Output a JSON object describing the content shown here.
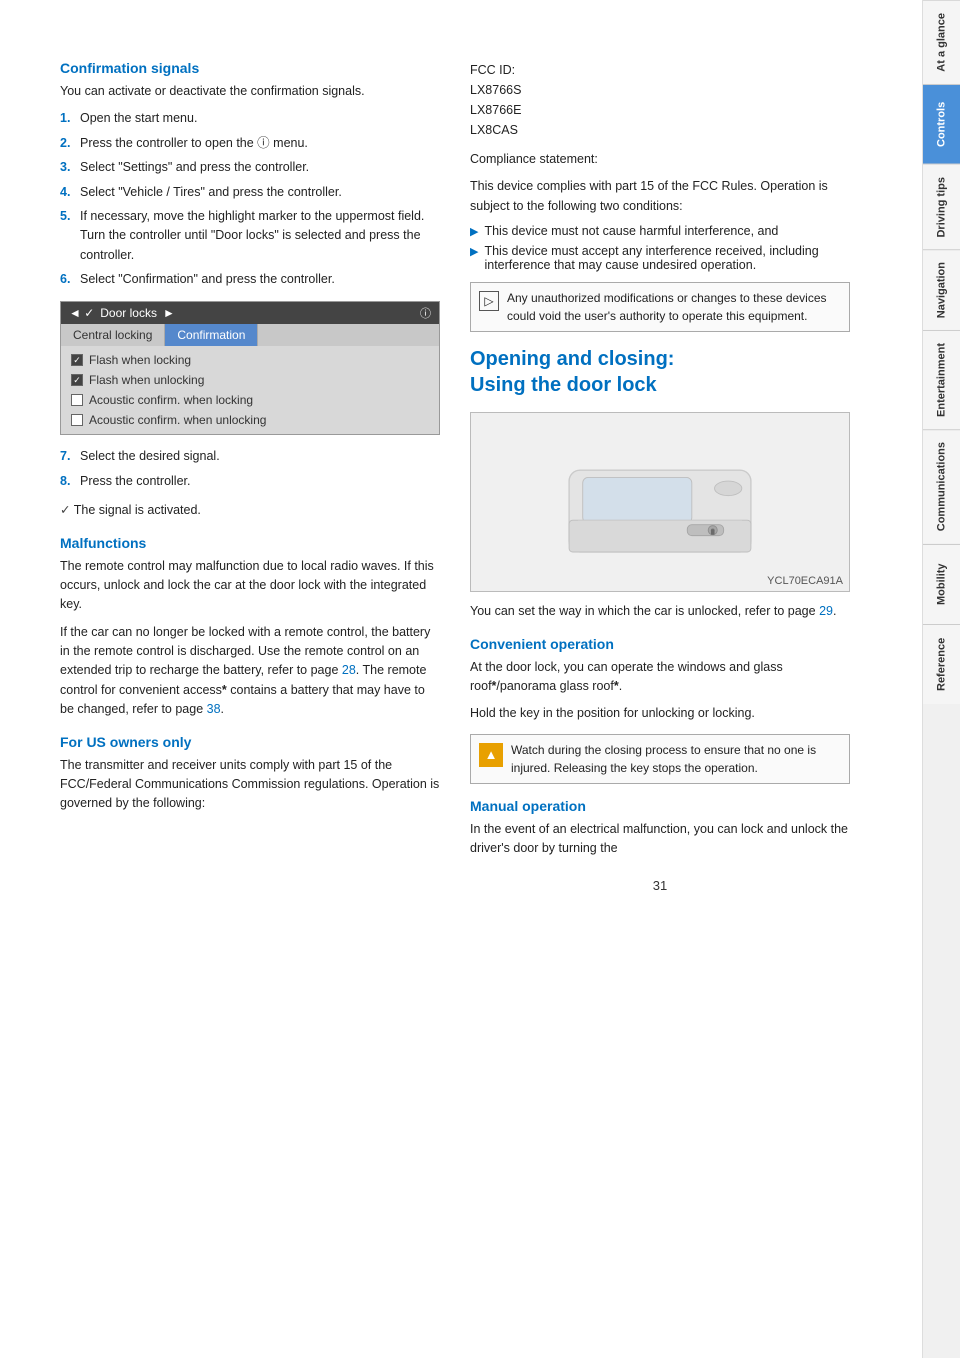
{
  "page": {
    "number": "31"
  },
  "sidebar": {
    "tabs": [
      {
        "id": "at-a-glance",
        "label": "At a glance",
        "active": false
      },
      {
        "id": "controls",
        "label": "Controls",
        "active": true
      },
      {
        "id": "driving-tips",
        "label": "Driving tips",
        "active": false
      },
      {
        "id": "navigation",
        "label": "Navigation",
        "active": false
      },
      {
        "id": "entertainment",
        "label": "Entertainment",
        "active": false
      },
      {
        "id": "communications",
        "label": "Communications",
        "active": false
      },
      {
        "id": "mobility",
        "label": "Mobility",
        "active": false
      },
      {
        "id": "reference",
        "label": "Reference",
        "active": false
      }
    ]
  },
  "left_column": {
    "confirmation_signals": {
      "heading": "Confirmation signals",
      "intro": "You can activate or deactivate the confirmation signals.",
      "steps": [
        {
          "num": "1.",
          "text": "Open the start menu."
        },
        {
          "num": "2.",
          "text": "Press the controller to open the ⓘ menu."
        },
        {
          "num": "3.",
          "text": "Select \"Settings\" and press the controller."
        },
        {
          "num": "4.",
          "text": "Select \"Vehicle / Tires\" and press the controller."
        },
        {
          "num": "5.",
          "text": "If necessary, move the highlight marker to the uppermost field. Turn the controller until \"Door locks\" is selected and press the controller."
        },
        {
          "num": "6.",
          "text": "Select \"Confirmation\" and press the controller."
        }
      ],
      "door_locks_ui": {
        "header_title": "Door locks",
        "tab_central": "Central locking",
        "tab_confirmation": "Confirmation",
        "options": [
          {
            "checked": true,
            "label": "Flash when locking"
          },
          {
            "checked": true,
            "label": "Flash when unlocking"
          },
          {
            "checked": false,
            "label": "Acoustic confirm. when locking"
          },
          {
            "checked": false,
            "label": "Acoustic confirm. when unlocking"
          }
        ]
      },
      "steps2": [
        {
          "num": "7.",
          "text": "Select the desired signal."
        },
        {
          "num": "8.",
          "text": "Press the controller."
        }
      ],
      "checkmark_note": "The signal is activated."
    },
    "malfunctions": {
      "heading": "Malfunctions",
      "para1": "The remote control may malfunction due to local radio waves. If this occurs, unlock and lock the car at the door lock with the integrated key.",
      "para2": "If the car can no longer be locked with a remote control, the battery in the remote control is discharged. Use the remote control on an extended trip to recharge the battery, refer to page 28. The remote control for convenient access* contains a battery that may have to be changed, refer to page 38."
    },
    "for_us_owners": {
      "heading": "For US owners only",
      "para1": "The transmitter and receiver units comply with part 15 of the FCC/Federal Communications Commission regulations. Operation is governed by the following:"
    }
  },
  "right_column": {
    "fcc": {
      "ids": "FCC ID:\nLX8766S\nLX8766E\nLX8CAS",
      "compliance_heading": "Compliance statement:",
      "compliance_text": "This device complies with part 15 of the FCC Rules. Operation is subject to the following two conditions:",
      "bullet1": "This device must not cause harmful interference, and",
      "bullet2": "This device must accept any interference received, including interference that may cause undesired operation.",
      "warning_text": "Any unauthorized modifications or changes to these devices could void the user's authority to operate this equipment."
    },
    "opening_closing": {
      "heading": "Opening and closing:\nUsing the door lock",
      "image_alt": "Car door lock illustration",
      "image_caption": "YCL70ECA91A",
      "body_text": "You can set the way in which the car is unlocked, refer to page 29.",
      "convenient_operation": {
        "heading": "Convenient operation",
        "para1": "At the door lock, you can operate the windows and glass roof*/panorama glass roof*.",
        "para2": "Hold the key in the position for unlocking or locking.",
        "caution": "Watch during the closing process to ensure that no one is injured. Releasing the key stops the operation."
      },
      "manual_operation": {
        "heading": "Manual operation",
        "para1": "In the event of an electrical malfunction, you can lock and unlock the driver's door by turning the"
      }
    }
  }
}
